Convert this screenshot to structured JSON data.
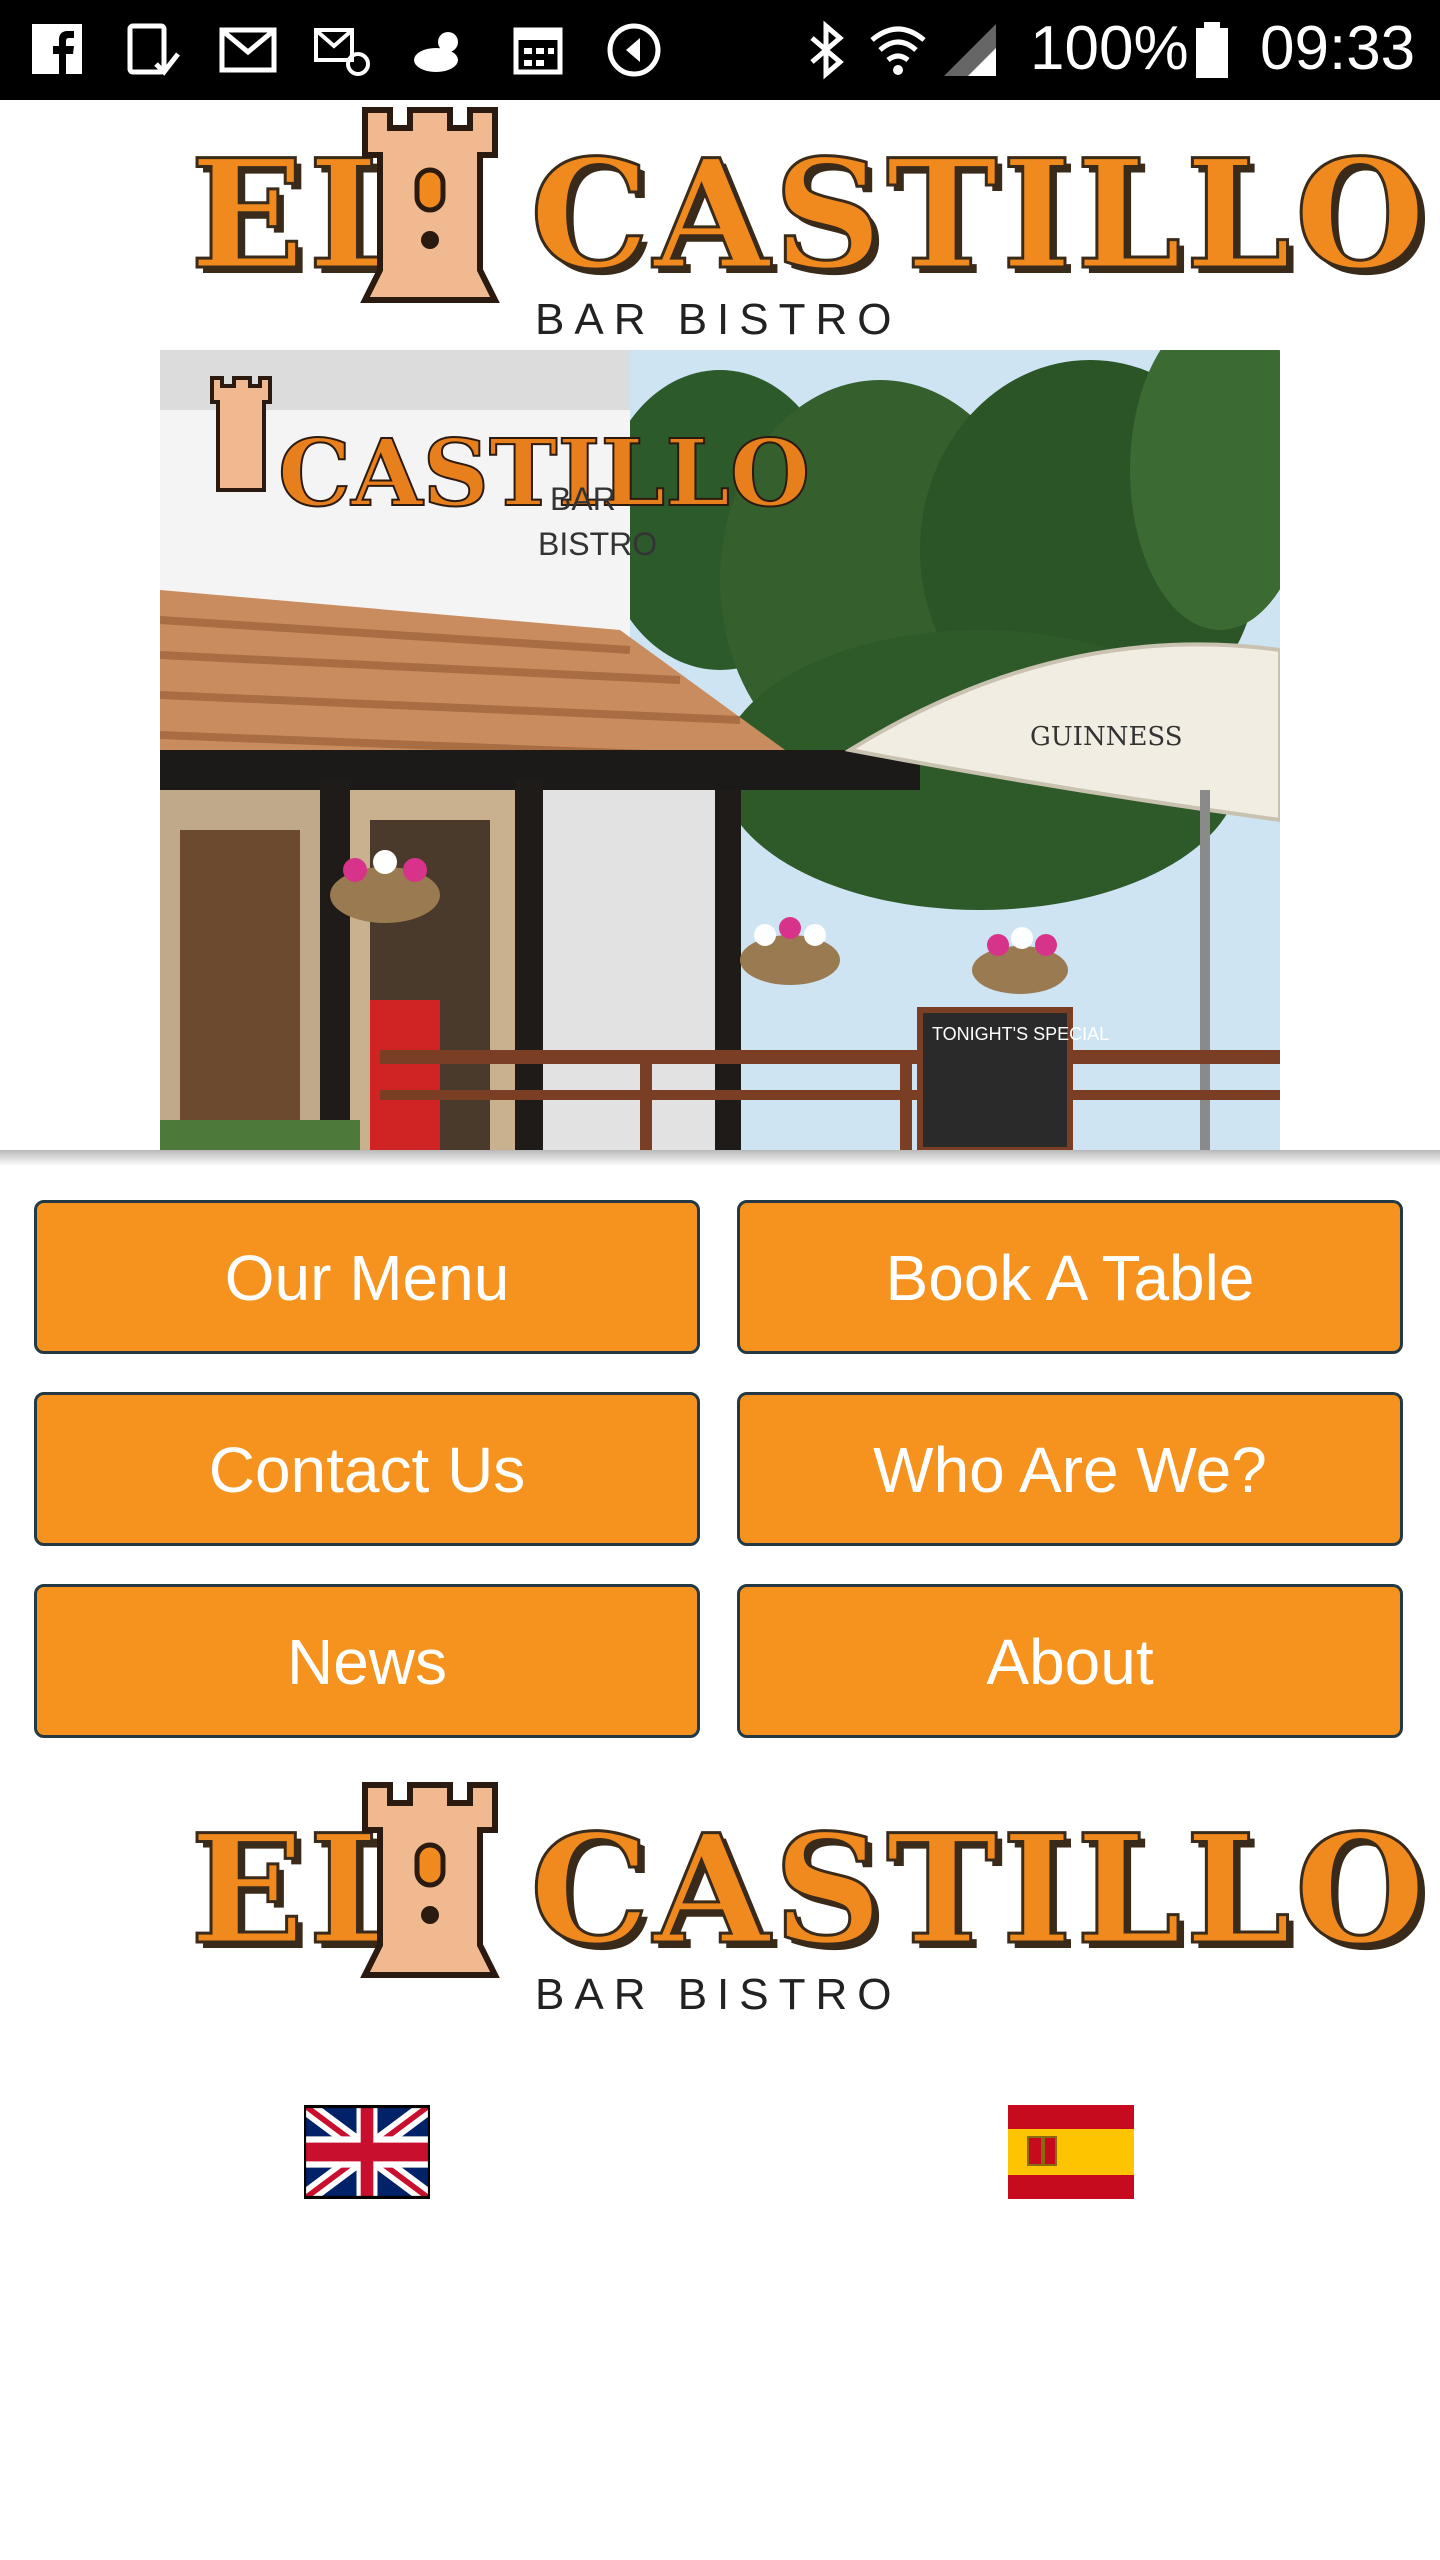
{
  "status_bar": {
    "battery": "100%",
    "time": "09:33",
    "icons": [
      "facebook-icon",
      "tablet-check-icon",
      "gmail-icon",
      "mail-at-icon",
      "partly-cloudy-icon",
      "calendar-icon",
      "media-icon",
      "bluetooth-icon",
      "wifi-icon",
      "signal-icon",
      "battery-icon"
    ]
  },
  "logo": {
    "word_left": "EL",
    "word_right": "CASTILLO",
    "subtitle": "BAR BISTRO"
  },
  "hero": {
    "sign_text": "CASTILLO",
    "sign_sub_1": "BAR",
    "sign_sub_2": "BISTRO",
    "umbrella_text": "GUINNESS",
    "board_text": "TONIGHT'S SPECIAL"
  },
  "nav": {
    "our_menu": "Our Menu",
    "book_a_table": "Book A Table",
    "contact_us": "Contact Us",
    "who_are_we": "Who Are We?",
    "news": "News",
    "about": "About"
  },
  "colors": {
    "accent": "#f6921e",
    "button_border": "#233a44",
    "logo_orange": "#f08a1e"
  },
  "flags": [
    "uk-flag-icon",
    "spain-flag-icon"
  ]
}
